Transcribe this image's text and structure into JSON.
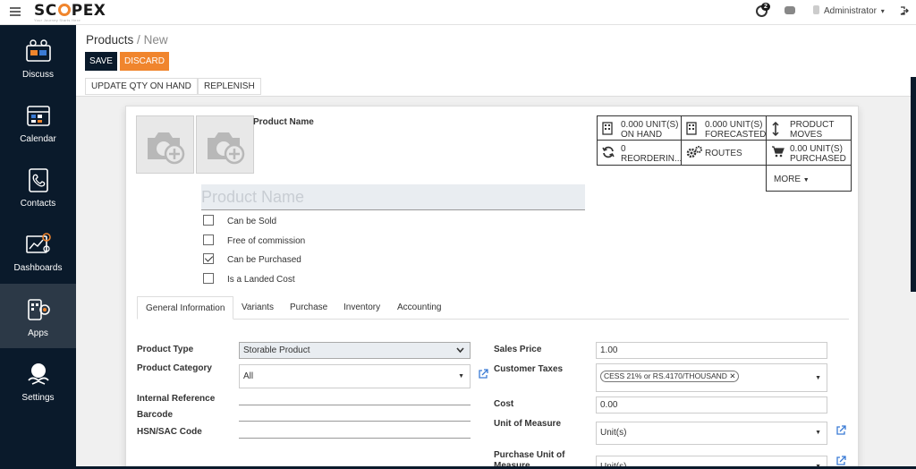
{
  "header": {
    "logo_left": "SC",
    "logo_right": "PEX",
    "logo_tagline": "Your Journey Starts Here",
    "activity_count": "2",
    "user_name": "Administrator",
    "user_caret": "▾"
  },
  "sidebar": {
    "items": [
      {
        "label": "Discuss"
      },
      {
        "label": "Calendar"
      },
      {
        "label": "Contacts"
      },
      {
        "label": "Dashboards"
      },
      {
        "label": "Apps"
      },
      {
        "label": "Settings"
      }
    ]
  },
  "breadcrumb": {
    "parent": "Products",
    "separator": "/",
    "current": "New"
  },
  "toolbar": {
    "save_label": "SAVE",
    "discard_label": "DISCARD"
  },
  "status_buttons": {
    "update_qty": "UPDATE QTY ON HAND",
    "replenish": "REPLENISH"
  },
  "form": {
    "product_name_label": "Product Name",
    "product_name_placeholder": "Product Name",
    "checkboxes": [
      {
        "label": "Can be Sold",
        "checked": false
      },
      {
        "label": "Free of commission",
        "checked": false
      },
      {
        "label": "Can be Purchased",
        "checked": true
      },
      {
        "label": "Is a Landed Cost",
        "checked": false
      }
    ]
  },
  "stats": {
    "on_hand_value": "0.000 UNIT(S)",
    "on_hand_label": "ON HAND",
    "forecasted_value": "0.000 UNIT(S)",
    "forecasted_label": "FORECASTED",
    "moves_line1": "PRODUCT",
    "moves_line2": "MOVES",
    "reordering_value": "0",
    "reordering_label": "REORDERIN...",
    "routes_label": "ROUTES",
    "purchased_value": "0.00 UNIT(S)",
    "purchased_label": "PURCHASED",
    "more_label": "MORE"
  },
  "tabs": [
    {
      "label": "General Information",
      "active": true
    },
    {
      "label": "Variants",
      "active": false
    },
    {
      "label": "Purchase",
      "active": false
    },
    {
      "label": "Inventory",
      "active": false
    },
    {
      "label": "Accounting",
      "active": false
    }
  ],
  "fields": {
    "product_type_label": "Product Type",
    "product_type_value": "Storable Product",
    "product_category_label": "Product Category",
    "product_category_value": "All",
    "internal_reference_label": "Internal Reference",
    "barcode_label": "Barcode",
    "hsn_label": "HSN/SAC Code",
    "sales_price_label": "Sales Price",
    "sales_price_value": "1.00",
    "customer_taxes_label": "Customer Taxes",
    "customer_taxes_tag": "CESS 21% or RS.4170/THOUSAND",
    "cost_label": "Cost",
    "cost_value": "0.00",
    "uom_label": "Unit of Measure",
    "uom_value": "Unit(s)",
    "purchase_uom_label_1": "Purchase Unit of",
    "purchase_uom_label_2": "Measure",
    "purchase_uom_value": "Unit(s)"
  },
  "colors": {
    "brand_dark": "#0a1a2b",
    "accent_orange": "#f0852d"
  }
}
